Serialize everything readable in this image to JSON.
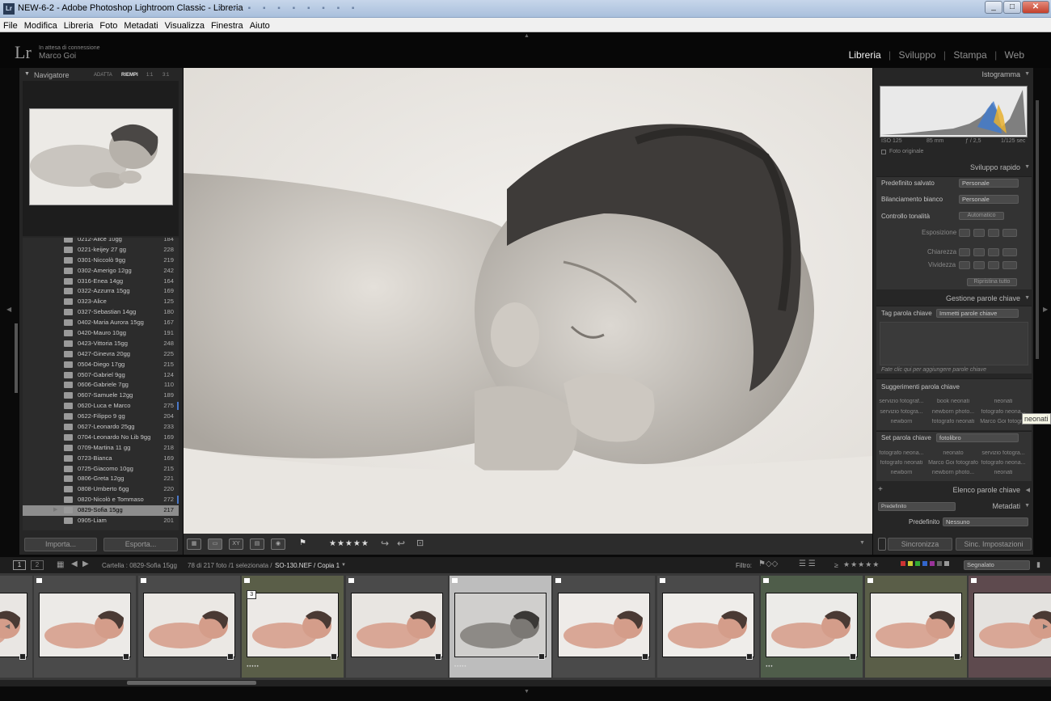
{
  "window": {
    "title": "NEW-6-2 - Adobe Photoshop Lightroom Classic - Libreria",
    "icon_text": "Lr"
  },
  "menu": [
    "File",
    "Modifica",
    "Libreria",
    "Foto",
    "Metadati",
    "Visualizza",
    "Finestra",
    "Aiuto"
  ],
  "identity": {
    "logo": "Lr",
    "status": "In attesa di connessione",
    "user": "Marco Goi"
  },
  "modules": {
    "items": [
      "Libreria",
      "Sviluppo",
      "Stampa",
      "Web"
    ],
    "active": "Libreria",
    "separator": "|"
  },
  "navigator": {
    "title": "Navigatore",
    "zoom": [
      "ADATTA",
      "RIEMPI",
      "1:1",
      "3:1"
    ],
    "active_zoom": "RIEMPI"
  },
  "folders": [
    {
      "name": "0212-Alice 10gg",
      "count": "184"
    },
    {
      "name": "0221-keijey 27 gg",
      "count": "228"
    },
    {
      "name": "0301-Niccolò 9gg",
      "count": "219"
    },
    {
      "name": "0302-Amerigo 12gg",
      "count": "242"
    },
    {
      "name": "0316-Enea 14gg",
      "count": "164"
    },
    {
      "name": "0322-Azzurra 15gg",
      "count": "169"
    },
    {
      "name": "0323-Alice",
      "count": "125"
    },
    {
      "name": "0327-Sebastian 14gg",
      "count": "180"
    },
    {
      "name": "0402-Maria Aurora 15gg",
      "count": "167"
    },
    {
      "name": "0420-Mauro 10gg",
      "count": "191"
    },
    {
      "name": "0423-Vittoria 15gg",
      "count": "248"
    },
    {
      "name": "0427-Ginevra 20gg",
      "count": "225"
    },
    {
      "name": "0504-Diego 17gg",
      "count": "215"
    },
    {
      "name": "0507-Gabriel 9gg",
      "count": "124"
    },
    {
      "name": "0606-Gabriele 7gg",
      "count": "110"
    },
    {
      "name": "0607-Samuele 12gg",
      "count": "189"
    },
    {
      "name": "0620-Luca e Marco",
      "count": "275"
    },
    {
      "name": "0622-Filippo 9 gg",
      "count": "204"
    },
    {
      "name": "0627-Leonardo 25gg",
      "count": "233"
    },
    {
      "name": "0704-Leonardo No Lib 9gg",
      "count": "169"
    },
    {
      "name": "0709-Martina 11 gg",
      "count": "218"
    },
    {
      "name": "0723-Bianca",
      "count": "169"
    },
    {
      "name": "0725-Giacomo 10gg",
      "count": "215"
    },
    {
      "name": "0806-Greta 12gg",
      "count": "221"
    },
    {
      "name": "0808-Umberto 6gg",
      "count": "220"
    },
    {
      "name": "0820-Nicolò e Tommaso",
      "count": "272"
    },
    {
      "name": "0829-Sofia 15gg",
      "count": "217"
    },
    {
      "name": "0905-Liam",
      "count": "201"
    }
  ],
  "left_buttons": {
    "import": "Importa...",
    "export": "Esporta..."
  },
  "toolbar": {
    "stars": "★★★★★"
  },
  "histogram": {
    "title": "Istogramma",
    "iso": "ISO 125",
    "focal": "85 mm",
    "aperture": "ƒ / 2,5",
    "shutter": "1/125 sec",
    "original": "Foto originale"
  },
  "quick_develop": {
    "title": "Sviluppo rapido",
    "preset_label": "Predefinito salvato",
    "preset_value": "Personale",
    "wb_label": "Bilanciamento bianco",
    "wb_value": "Personale",
    "tone_label": "Controllo tonalità",
    "auto": "Automatico",
    "exposure": "Esposizione",
    "clarity": "Chiarezza",
    "vibrance": "Vividezza",
    "reset": "Ripristina tutto"
  },
  "keywording": {
    "title": "Gestione parole chiave",
    "tag_label": "Tag parola chiave",
    "tag_value": "Immetti parole chiave",
    "hint": "Fate clic qui per aggiungere parole chiave",
    "suggest_title": "Suggerimenti parola chiave",
    "suggestions": [
      "servizio fotograf...",
      "book neonati",
      "neonati",
      "servizio fotogra...",
      "newborn photo...",
      "fotografo neona...",
      "newborn",
      "fotografo neonati",
      "Marco Goi fotogr..."
    ],
    "set_label": "Set parola chiave",
    "set_value": "fotolibro",
    "set_items": [
      "fotografo neona...",
      "neonato",
      "servizio fotogra...",
      "fotografo neonati",
      "Marco Goi fotografo",
      "fotografo neona...",
      "newborn",
      "newborn photo...",
      "neonati"
    ],
    "tooltip": "neonati"
  },
  "keyword_list": {
    "title": "Elenco parole chiave"
  },
  "metadata": {
    "title": "Metadati",
    "preset_select": "Predefinito",
    "preset_label": "Predefinito",
    "preset_value": "Nessuno"
  },
  "right_buttons": {
    "sync": "Sincronizza",
    "sync_settings": "Sinc. Impostazioni"
  },
  "filmbar": {
    "page1": "1",
    "page2": "2",
    "source": "Cartella : 0829-Sofia 15gg",
    "count": "78 di 217 foto /1 selezionata /",
    "file": "SO-130.NEF / Copia 1",
    "filter_label": "Filtro:",
    "ge": "≥",
    "stars": "★★★★★",
    "filter_value": "Segnalato"
  },
  "filmstrip": [
    {
      "bg": "#4a4a4a",
      "stars": "",
      "num": ""
    },
    {
      "bg": "#4a4a4a",
      "stars": "",
      "num": ""
    },
    {
      "bg": "#4a4a4a",
      "stars": "",
      "num": ""
    },
    {
      "bg": "#5a5e48",
      "stars": "•••••",
      "num": "3"
    },
    {
      "bg": "#4a4a4a",
      "stars": "",
      "num": ""
    },
    {
      "bg": "#bdbdbd",
      "stars": "•••••",
      "num": ""
    },
    {
      "bg": "#4a4a4a",
      "stars": "",
      "num": ""
    },
    {
      "bg": "#4a4a4a",
      "stars": "",
      "num": ""
    },
    {
      "bg": "#4f5d4a",
      "stars": "•••",
      "num": ""
    },
    {
      "bg": "#5a5e48",
      "stars": "",
      "num": ""
    },
    {
      "bg": "#5e4a4e",
      "stars": "",
      "num": ""
    }
  ]
}
